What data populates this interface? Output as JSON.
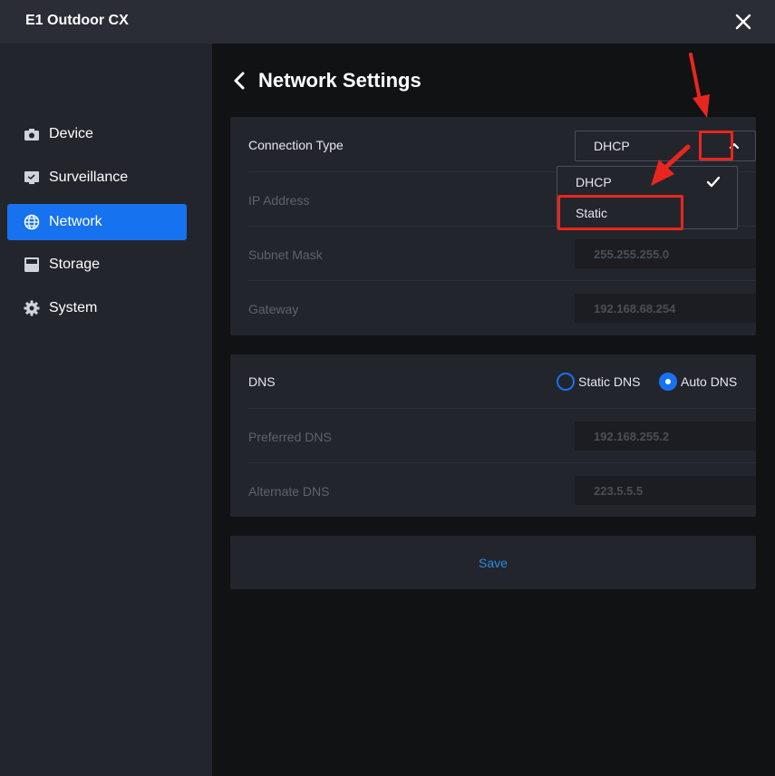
{
  "app": {
    "title": "E1 Outdoor CX",
    "close_icon": "close-icon"
  },
  "sidebar": {
    "items": [
      {
        "label": "Device",
        "icon": "camera-icon",
        "active": false
      },
      {
        "label": "Surveillance",
        "icon": "monitor-icon",
        "active": false
      },
      {
        "label": "Network",
        "icon": "globe-icon",
        "active": true
      },
      {
        "label": "Storage",
        "icon": "storage-icon",
        "active": false
      },
      {
        "label": "System",
        "icon": "gear-icon",
        "active": false
      }
    ]
  },
  "page": {
    "title": "Network Settings",
    "back_icon": "chevron-left-icon"
  },
  "connection": {
    "label": "Connection Type",
    "selected": "DHCP",
    "options": [
      "DHCP",
      "Static"
    ],
    "ip_label": "IP Address",
    "subnet_label": "Subnet Mask",
    "subnet_value": "255.255.255.0",
    "gateway_label": "Gateway",
    "gateway_value": "192.168.68.254"
  },
  "dns": {
    "label": "DNS",
    "static_label": "Static DNS",
    "auto_label": "Auto DNS",
    "selected": "Auto DNS",
    "preferred_label": "Preferred DNS",
    "preferred_value": "192.168.255.2",
    "alternate_label": "Alternate DNS",
    "alternate_value": "223.5.5.5"
  },
  "save_label": "Save",
  "colors": {
    "accent": "#1672ef",
    "annotation": "#e8261f",
    "save_text": "#2b8ce0"
  }
}
